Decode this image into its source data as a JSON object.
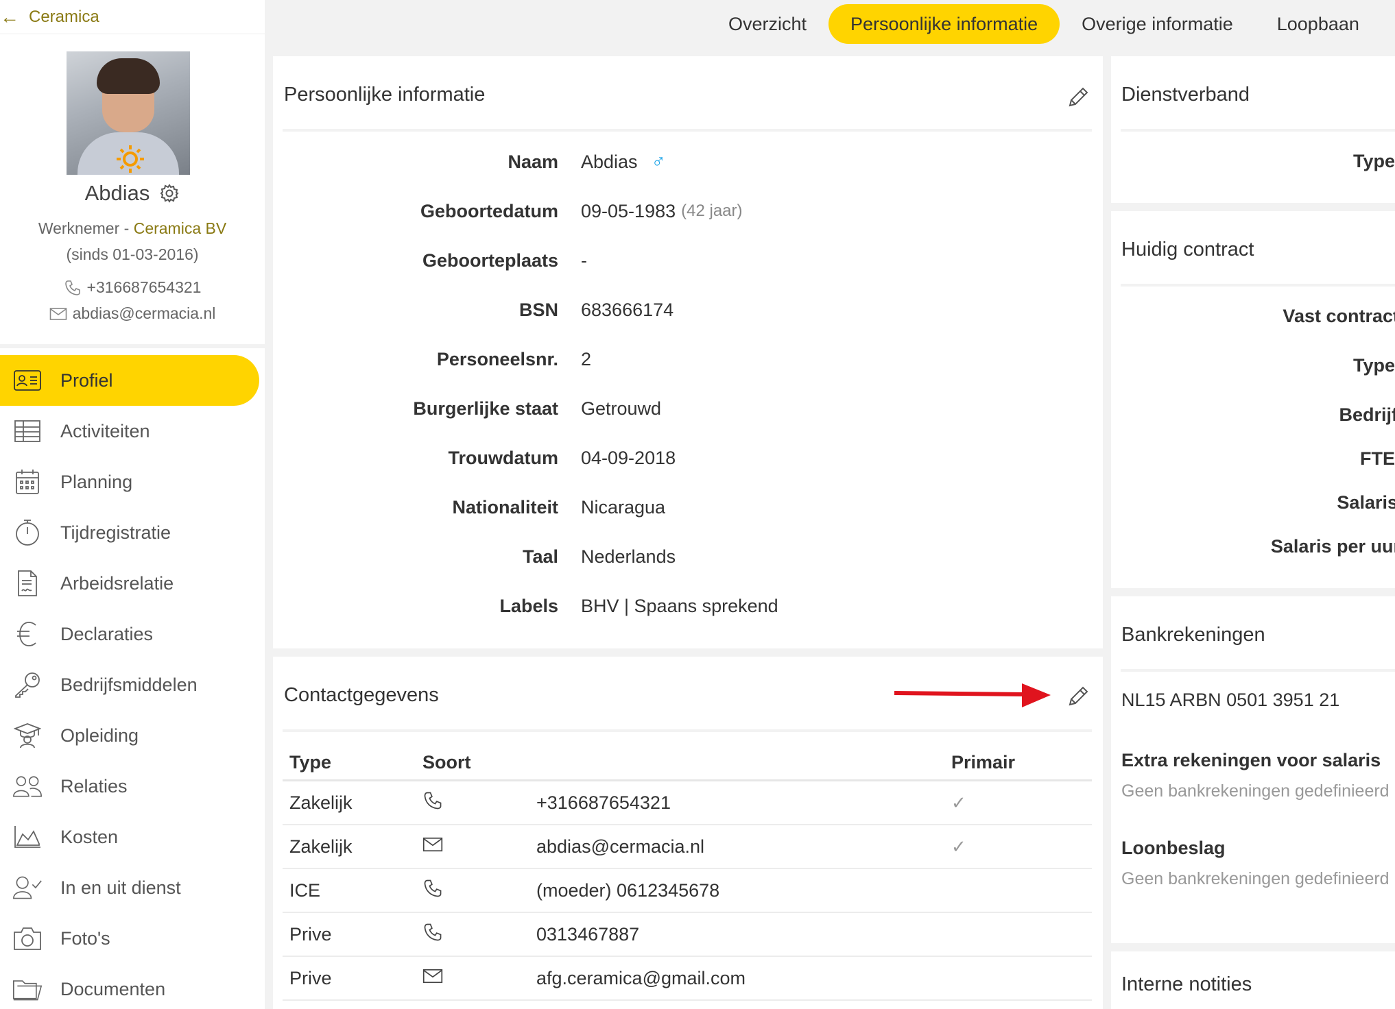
{
  "sidebar": {
    "back_label": "Ceramica",
    "profile_name": "Abdias",
    "role": "Werknemer - ",
    "company": "Ceramica BV",
    "since": "(sinds 01-03-2016)",
    "phone": "+316687654321",
    "email": "abdias@cermacia.nl",
    "nav": [
      {
        "label": "Profiel",
        "icon": "id-card-icon",
        "active": true
      },
      {
        "label": "Activiteiten",
        "icon": "table-icon"
      },
      {
        "label": "Planning",
        "icon": "calendar-icon"
      },
      {
        "label": "Tijdregistratie",
        "icon": "stopwatch-icon"
      },
      {
        "label": "Arbeidsrelatie",
        "icon": "contract-icon"
      },
      {
        "label": "Declaraties",
        "icon": "euro-icon"
      },
      {
        "label": "Bedrijfsmiddelen",
        "icon": "key-icon"
      },
      {
        "label": "Opleiding",
        "icon": "graduation-icon"
      },
      {
        "label": "Relaties",
        "icon": "people-icon"
      },
      {
        "label": "Kosten",
        "icon": "area-chart-icon"
      },
      {
        "label": "In en uit dienst",
        "icon": "user-check-icon"
      },
      {
        "label": "Foto's",
        "icon": "camera-icon"
      },
      {
        "label": "Documenten",
        "icon": "folder-icon"
      }
    ]
  },
  "tabs": [
    {
      "label": "Overzicht"
    },
    {
      "label": "Persoonlijke informatie",
      "active": true
    },
    {
      "label": "Overige informatie"
    },
    {
      "label": "Loopbaan"
    }
  ],
  "personal": {
    "title": "Persoonlijke informatie",
    "rows": [
      {
        "label": "Naam",
        "value": "Abdias",
        "extra": "♂"
      },
      {
        "label": "Geboortedatum",
        "value": "09-05-1983",
        "muted": "(42 jaar)"
      },
      {
        "label": "Geboorteplaats",
        "value": "-"
      },
      {
        "label": "BSN",
        "value": "683666174"
      },
      {
        "label": "Personeelsnr.",
        "value": "2"
      },
      {
        "label": "Burgerlijke staat",
        "value": "Getrouwd"
      },
      {
        "label": "Trouwdatum",
        "value": "04-09-2018"
      },
      {
        "label": "Nationaliteit",
        "value": "Nicaragua"
      },
      {
        "label": "Taal",
        "value": "Nederlands"
      },
      {
        "label": "Labels",
        "value": "BHV | Spaans sprekend"
      }
    ]
  },
  "contact": {
    "title": "Contactgegevens",
    "headers": {
      "type": "Type",
      "soort": "Soort",
      "primair": "Primair"
    },
    "rows": [
      {
        "type": "Zakelijk",
        "soort": "phone-icon",
        "value": "+316687654321",
        "primary": true
      },
      {
        "type": "Zakelijk",
        "soort": "mail-icon",
        "value": "abdias@cermacia.nl",
        "primary": true
      },
      {
        "type": "ICE",
        "soort": "phone-icon",
        "value": "(moeder) 0612345678",
        "primary": false
      },
      {
        "type": "Prive",
        "soort": "phone-icon",
        "value": "0313467887",
        "primary": false
      },
      {
        "type": "Prive",
        "soort": "mail-icon",
        "value": "afg.ceramica@gmail.com",
        "primary": false
      }
    ],
    "check_glyph": "✓"
  },
  "right": {
    "dienstverband": {
      "title": "Dienstverband",
      "labels": [
        "Type"
      ]
    },
    "contract": {
      "title": "Huidig contract",
      "labels": [
        "Vast contract",
        "Type",
        "Bedrijf",
        "FTE",
        "Salaris",
        "Salaris per uur"
      ]
    },
    "bank": {
      "title": "Bankrekeningen",
      "iban": "NL15 ARBN 0501 3951 21",
      "extra_title": "Extra rekeningen voor salaris",
      "extra_empty": "Geen bankrekeningen gedefinieerd",
      "loonbeslag_title": "Loonbeslag",
      "loonbeslag_empty": "Geen bankrekeningen gedefinieerd"
    },
    "notes": {
      "title": "Interne notities"
    }
  },
  "colors": {
    "accent": "#ffd400",
    "link": "#8a7a14",
    "annotation_arrow": "#e0141e",
    "male": "#1aa3e8"
  }
}
